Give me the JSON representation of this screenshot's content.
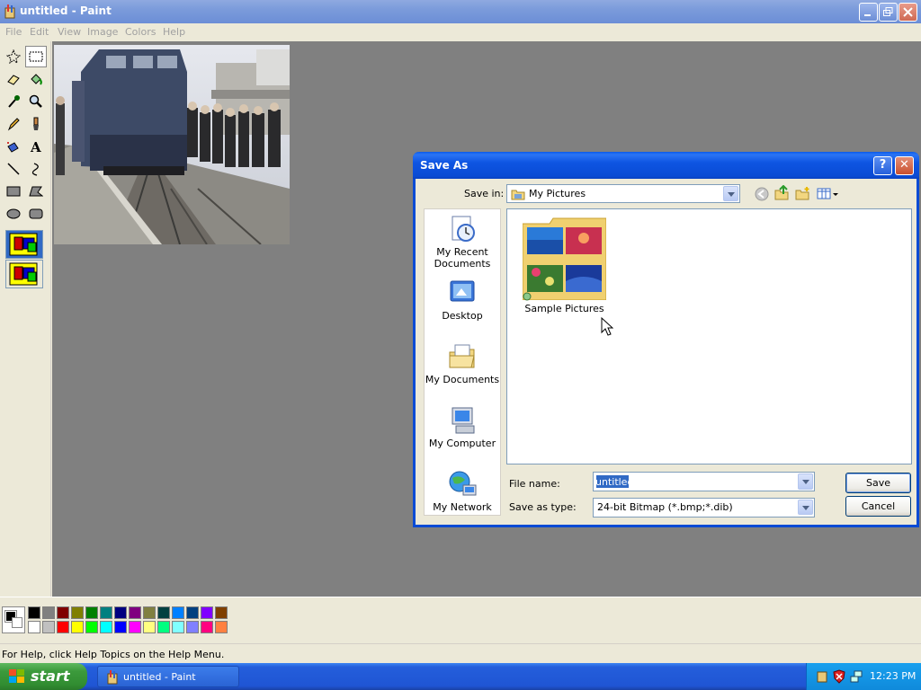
{
  "window": {
    "title": "untitled - Paint"
  },
  "menu": [
    "File",
    "Edit",
    "View",
    "Image",
    "Colors",
    "Help"
  ],
  "status_text": "For Help, click Help Topics on the Help Menu.",
  "palette": {
    "top": [
      "#000000",
      "#808080",
      "#800000",
      "#808000",
      "#008000",
      "#008080",
      "#000080",
      "#800080",
      "#808040",
      "#004040",
      "#0080FF",
      "#004080",
      "#8000FF",
      "#804000"
    ],
    "bottom": [
      "#FFFFFF",
      "#C0C0C0",
      "#FF0000",
      "#FFFF00",
      "#00FF00",
      "#00FFFF",
      "#0000FF",
      "#FF00FF",
      "#FFFF80",
      "#00FF80",
      "#80FFFF",
      "#8080FF",
      "#FF0080",
      "#FF8040"
    ]
  },
  "taskbar": {
    "start_label": "start",
    "task_label": "untitled - Paint",
    "clock": "12:23 PM"
  },
  "dialog": {
    "title": "Save As",
    "help_glyph": "?",
    "close_glyph": "✕",
    "save_in_label": "Save in:",
    "save_in_value": "My Pictures",
    "places": [
      {
        "line1": "My Recent",
        "line2": "Documents"
      },
      {
        "line1": "Desktop",
        "line2": ""
      },
      {
        "line1": "My Documents",
        "line2": ""
      },
      {
        "line1": "My Computer",
        "line2": ""
      },
      {
        "line1": "My Network",
        "line2": ""
      }
    ],
    "folder_label": "Sample Pictures",
    "file_name_label": "File name:",
    "file_name_value": "untitled",
    "save_type_label": "Save as type:",
    "save_type_value": "24-bit Bitmap (*.bmp;*.dib)",
    "save_button": "Save",
    "cancel_button": "Cancel"
  }
}
